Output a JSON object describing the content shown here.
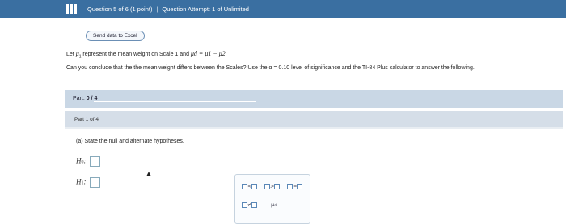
{
  "header": {
    "question_info": "Question 5 of 6 (1 point)",
    "attempt_label": "Question Attempt: 1 of Unlimited",
    "menu_icon": "hamburger-icon"
  },
  "toolbar": {
    "send_label": "Send data to Excel"
  },
  "problem": {
    "line1_pre": "Let ",
    "line1_mu": "μ",
    "line1_sub": "1",
    "line1_mid": " represent the mean weight on Scale 1 and ",
    "line1_def": "μd = μ1 − μ2.",
    "line2": "Can you conclude that the the mean weight differs between the Scales? Use the α = 0.10 level of significance and the TI-84 Plus calculator to answer the following."
  },
  "part": {
    "label": "Part:",
    "progress_text": "0 / 4",
    "progress_fraction": 0.0
  },
  "part1": {
    "title": "Part 1 of 4",
    "instruction": "(a) State the null and alternate hypotheses.",
    "h0_label": "H",
    "h0_sub": "0",
    "h1_label": "H",
    "h1_sub": "1",
    "symbols": {
      "lt": "<",
      "gt": ">",
      "eq": "=",
      "ne": "≠",
      "mu": "μ"
    }
  }
}
